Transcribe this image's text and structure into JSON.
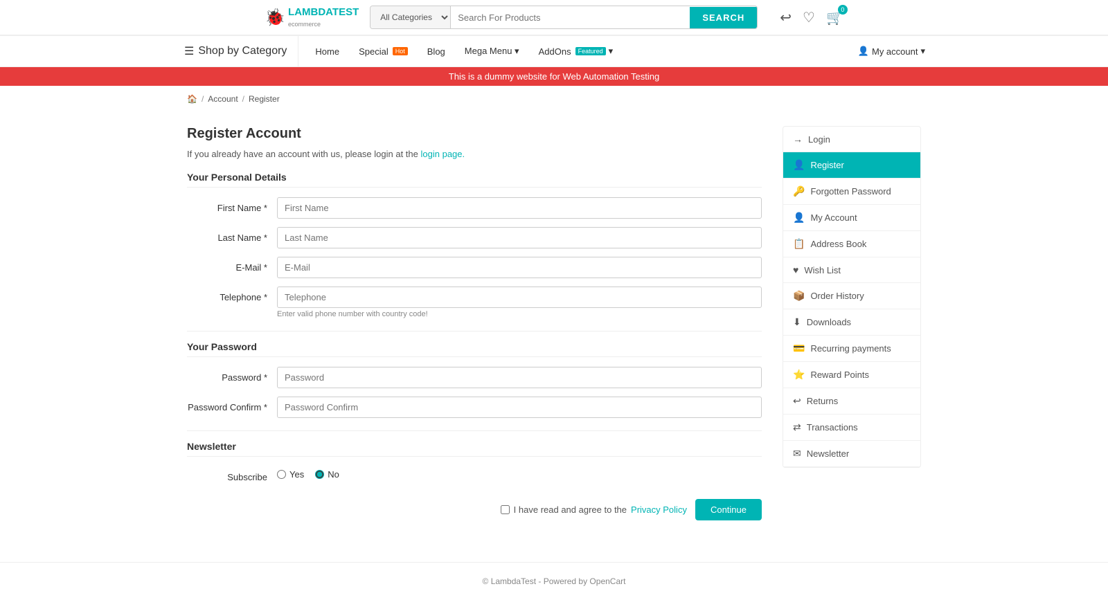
{
  "header": {
    "logo_text": "LAMBDATEST",
    "logo_sub": "ecommerce",
    "categories_placeholder": "All Categories",
    "search_placeholder": "Search For Products",
    "search_btn_label": "SEARCH",
    "cart_count": "0",
    "icons": {
      "back": "↩",
      "wishlist": "♡",
      "cart": "🛒"
    }
  },
  "nav": {
    "shop_by_category": "Shop by Category",
    "links": [
      {
        "label": "Home",
        "special": false,
        "featured": false
      },
      {
        "label": "Special",
        "special": true,
        "badge": "Hot",
        "featured": false
      },
      {
        "label": "Blog",
        "special": false,
        "featured": false
      },
      {
        "label": "Mega Menu",
        "special": false,
        "featured": false,
        "dropdown": true
      },
      {
        "label": "AddOns",
        "special": false,
        "featured": true,
        "badge": "Featured",
        "dropdown": true
      }
    ],
    "account": "My account"
  },
  "banner": {
    "text": "This is a dummy website for Web Automation Testing"
  },
  "breadcrumb": {
    "home_icon": "🏠",
    "items": [
      "Account",
      "Register"
    ]
  },
  "form": {
    "title": "Register Account",
    "login_notice": "If you already have an account with us, please login at the",
    "login_link_text": "login page.",
    "personal_details_title": "Your Personal Details",
    "fields": [
      {
        "label": "First Name *",
        "placeholder": "First Name",
        "type": "text",
        "hint": ""
      },
      {
        "label": "Last Name *",
        "placeholder": "Last Name",
        "type": "text",
        "hint": ""
      },
      {
        "label": "E-Mail *",
        "placeholder": "E-Mail",
        "type": "text",
        "hint": ""
      },
      {
        "label": "Telephone *",
        "placeholder": "Telephone",
        "type": "text",
        "hint": "Enter valid phone number with country code!"
      }
    ],
    "password_title": "Your Password",
    "password_fields": [
      {
        "label": "Password *",
        "placeholder": "Password",
        "type": "password",
        "hint": ""
      },
      {
        "label": "Password Confirm *",
        "placeholder": "Password Confirm",
        "type": "password",
        "hint": ""
      }
    ],
    "newsletter_title": "Newsletter",
    "subscribe_label": "Subscribe",
    "subscribe_options": [
      "Yes",
      "No"
    ],
    "subscribe_default": "No",
    "agree_text": "I have read and agree to the",
    "privacy_link": "Privacy Policy",
    "continue_btn": "Continue"
  },
  "sidebar": {
    "items": [
      {
        "label": "Login",
        "icon": "→",
        "active": false
      },
      {
        "label": "Register",
        "icon": "👤",
        "active": true
      },
      {
        "label": "Forgotten Password",
        "icon": "🔑",
        "active": false
      },
      {
        "label": "My Account",
        "icon": "👤",
        "active": false
      },
      {
        "label": "Address Book",
        "icon": "📋",
        "active": false
      },
      {
        "label": "Wish List",
        "icon": "♥",
        "active": false
      },
      {
        "label": "Order History",
        "icon": "📦",
        "active": false
      },
      {
        "label": "Downloads",
        "icon": "⬇",
        "active": false
      },
      {
        "label": "Recurring payments",
        "icon": "💳",
        "active": false
      },
      {
        "label": "Reward Points",
        "icon": "⭐",
        "active": false
      },
      {
        "label": "Returns",
        "icon": "↩",
        "active": false
      },
      {
        "label": "Transactions",
        "icon": "⇄",
        "active": false
      },
      {
        "label": "Newsletter",
        "icon": "✉",
        "active": false
      }
    ]
  },
  "footer": {
    "text": "© LambdaTest - Powered by OpenCart"
  }
}
